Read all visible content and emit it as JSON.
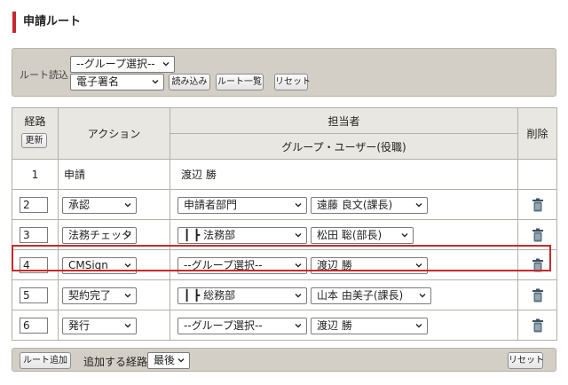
{
  "page": {
    "title": "申請ルート"
  },
  "route_load": {
    "label": "ルート読込",
    "group_select": "--グループ選択--",
    "route_select": "電子署名",
    "load_button": "読み込み",
    "list_button": "ルート一覧",
    "reset_button": "リセット"
  },
  "table": {
    "headers": {
      "step": "経路",
      "update_button": "更新",
      "action": "アクション",
      "assignee": "担当者",
      "assignee_sub": "グループ・ユーザー(役職)",
      "delete": "削除"
    },
    "rows": [
      {
        "step": "1",
        "action": "申請",
        "group": "",
        "user": "渡辺 勝"
      },
      {
        "step": "2",
        "action": "承認",
        "group": "申請者部門",
        "user": "遠藤 良文(課長)"
      },
      {
        "step": "3",
        "action": "法務チェック",
        "group": "┃ ┣ 法務部",
        "user": "松田 聡(部長)"
      },
      {
        "step": "4",
        "action": "CMSign",
        "group": "--グループ選択--",
        "user": "渡辺 勝"
      },
      {
        "step": "5",
        "action": "契約完了",
        "group": "┃ ┣ 総務部",
        "user": "山本 由美子(課長)"
      },
      {
        "step": "6",
        "action": "発行",
        "group": "--グループ選択--",
        "user": "渡辺 勝"
      }
    ]
  },
  "bottom": {
    "add_route_button": "ルート追加",
    "position_label": "追加する経路",
    "position_select": "最後",
    "reset_button": "リセット"
  },
  "colors": {
    "accent": "#c8282c",
    "panel": "#d3cfc6",
    "header": "#e9e7e2"
  },
  "icons": {
    "dropdown": "chevron-down-icon",
    "delete": "trash-icon"
  }
}
